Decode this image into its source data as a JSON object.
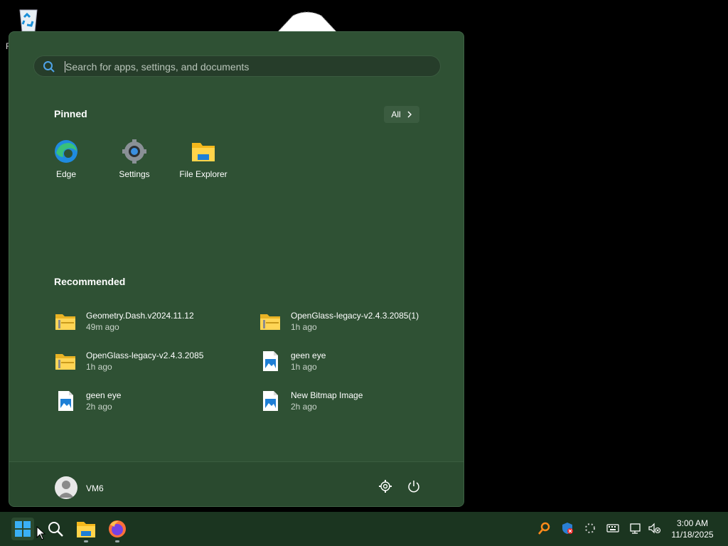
{
  "desktop": {
    "recycle_bin_label": "R"
  },
  "start_menu": {
    "search": {
      "placeholder": "Search for apps, settings, and documents"
    },
    "pinned": {
      "title": "Pinned",
      "all_button": "All",
      "items": [
        {
          "label": "Edge",
          "icon": "edge-icon"
        },
        {
          "label": "Settings",
          "icon": "settings-gear-icon"
        },
        {
          "label": "File Explorer",
          "icon": "folder-icon"
        }
      ]
    },
    "recommended": {
      "title": "Recommended",
      "items": [
        {
          "name": "Geometry.Dash.v2024.11.12",
          "time": "49m ago",
          "icon": "zip-folder-icon"
        },
        {
          "name": "OpenGlass-legacy-v2.4.3.2085(1)",
          "time": "1h ago",
          "icon": "zip-folder-icon"
        },
        {
          "name": "OpenGlass-legacy-v2.4.3.2085",
          "time": "1h ago",
          "icon": "zip-folder-icon"
        },
        {
          "name": "geen eye",
          "time": "1h ago",
          "icon": "image-file-icon"
        },
        {
          "name": "geen eye",
          "time": "2h ago",
          "icon": "image-file-icon"
        },
        {
          "name": "New Bitmap Image",
          "time": "2h ago",
          "icon": "image-file-icon"
        }
      ]
    },
    "footer": {
      "username": "VM6"
    }
  },
  "taskbar": {
    "clock": {
      "time": "3:00 AM",
      "date": "11/18/2025"
    }
  },
  "colors": {
    "start_bg": "#2f5134",
    "taskbar_bg": "#1b3520",
    "accent": "#0078d4"
  }
}
